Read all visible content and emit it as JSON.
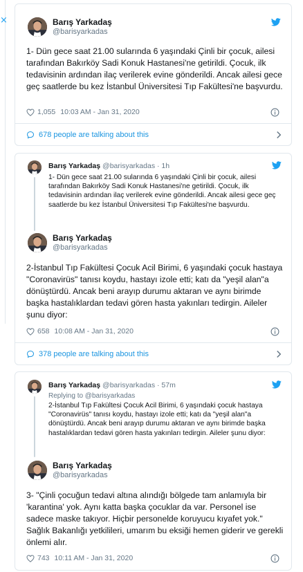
{
  "side": {
    "close_glyph": "×"
  },
  "colors": {
    "accent": "#1da1f2",
    "link": "#1b95e0",
    "muted": "#657786",
    "border": "#e1e8ed"
  },
  "tweet1": {
    "name": "Barış Yarkadaş",
    "handle": "@barisyarkadas",
    "text": "1- Dün gece saat 21.00 sularında 6 yaşındaki Çinli bir çocuk, ailesi tarafından Bakırköy Sadi Konuk Hastanesi'ne getirildi. Çocuk, ilk tedavisinin ardından ilaç verilerek evine gönderildi. Ancak ailesi gece geç saatlerde bu kez İstanbul Üniversitesi Tıp Fakültesi'ne başvurdu.",
    "likes": "1,055",
    "time": "10:03 AM - Jan 31, 2020",
    "talking": "678 people are talking about this"
  },
  "tweet2": {
    "quote": {
      "name": "Barış Yarkadaş",
      "handle": "@barisyarkadas",
      "age": "1h",
      "text": "1- Dün gece saat 21.00 sularında 6 yaşındaki Çinli bir çocuk, ailesi tarafından Bakırköy Sadi Konuk Hastanesi'ne getirildi. Çocuk, ilk tedavisinin ardından ilaç verilerek evine gönderildi. Ancak ailesi gece geç saatlerde bu kez İstanbul Üniversitesi Tıp Fakültesi'ne başvurdu."
    },
    "name": "Barış Yarkadaş",
    "handle": "@barisyarkadas",
    "text": "2-İstanbul Tıp Fakültesi Çocuk Acil Birimi, 6 yaşındaki çocuk hastaya \"Coronavirüs\" tanısı koydu, hastayı izole etti; katı da \"yeşil alan\"a dönüştürdü. Ancak beni arayıp durumu aktaran ve aynı birimde başka hastalıklardan tedavi gören hasta yakınları tedirgin. Aileler şunu diyor:",
    "likes": "658",
    "time": "10:08 AM - Jan 31, 2020",
    "talking": "378 people are talking about this"
  },
  "tweet3": {
    "quote": {
      "name": "Barış Yarkadaş",
      "handle": "@barisyarkadas",
      "age": "57m",
      "replying": "Replying to @barisyarkadas",
      "text": "2-İstanbul Tıp Fakültesi Çocuk Acil Birimi, 6 yaşındaki çocuk hastaya \"Coronavirüs\" tanısı koydu, hastayı izole etti; katı da \"yeşil alan\"a dönüştürdü. Ancak beni arayıp durumu aktaran ve aynı birimde başka hastalıklardan tedavi gören hasta yakınları tedirgin. Aileler şunu diyor:"
    },
    "name": "Barış Yarkadaş",
    "handle": "@barisyarkadas",
    "text": "3- \"Çinli çocuğun tedavi altına alındığı bölgede tam anlamıyla bir 'karantina' yok. Aynı katta başka çocuklar da var. Personel ise sadece maske takıyor. Hiçbir personelde koruyucu kıyafet yok.\" Sağlık Bakanlığı yetkilileri, umarım bu eksiği hemen giderir ve gerekli önlemi alır.",
    "likes": "743",
    "time": "10:11 AM - Jan 31, 2020"
  }
}
